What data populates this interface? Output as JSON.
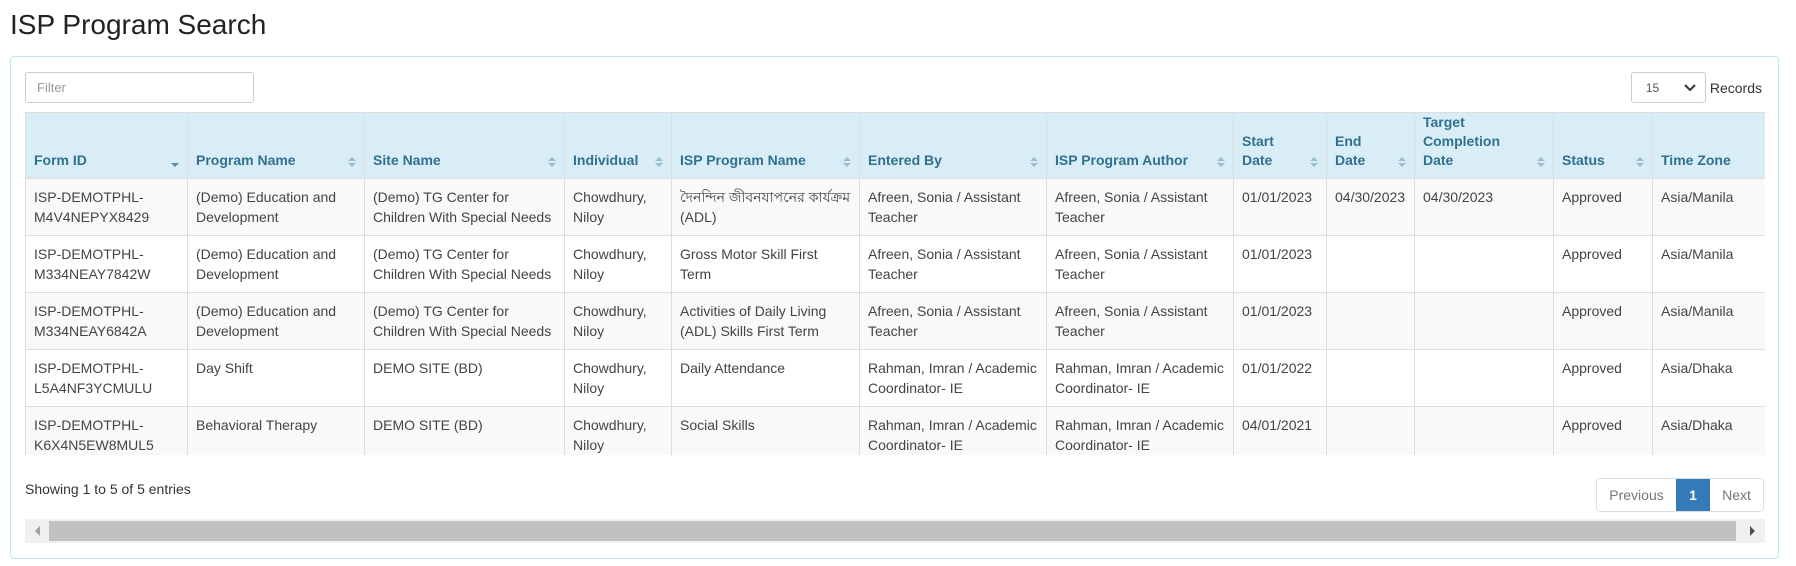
{
  "page": {
    "title": "ISP Program Search"
  },
  "toolbar": {
    "filter_placeholder": "Filter",
    "filter_value": "",
    "records_value": "15",
    "records_label": "Records"
  },
  "table": {
    "columns": [
      {
        "label": "Form ID",
        "sort": "desc"
      },
      {
        "label": "Program Name",
        "sort": "none"
      },
      {
        "label": "Site Name",
        "sort": "none"
      },
      {
        "label": "Individual",
        "sort": "none"
      },
      {
        "label": "ISP Program Name",
        "sort": "none"
      },
      {
        "label": "Entered By",
        "sort": "none"
      },
      {
        "label": "ISP Program Author",
        "sort": "none"
      },
      {
        "label": "Start Date",
        "sort": "none"
      },
      {
        "label": "End Date",
        "sort": "none"
      },
      {
        "label": "Target Completion Date",
        "sort": "none"
      },
      {
        "label": "Status",
        "sort": "none"
      },
      {
        "label": "Time Zone",
        "sort": "none"
      }
    ],
    "rows": [
      [
        "ISP-DEMOTPHL-M4V4NEPYX8429",
        "(Demo) Education and Development",
        "(Demo) TG Center for Children With Special Needs",
        "Chowdhury, Niloy",
        "দৈনন্দিন জীবনযাপনের কার্যক্রম (ADL)",
        "Afreen, Sonia / Assistant Teacher",
        "Afreen, Sonia / Assistant Teacher",
        "01/01/2023",
        "04/30/2023",
        "04/30/2023",
        "Approved",
        "Asia/Manila"
      ],
      [
        "ISP-DEMOTPHL-M334NEAY7842W",
        "(Demo) Education and Development",
        "(Demo) TG Center for Children With Special Needs",
        "Chowdhury, Niloy",
        "Gross Motor Skill First Term",
        "Afreen, Sonia / Assistant Teacher",
        "Afreen, Sonia / Assistant Teacher",
        "01/01/2023",
        "",
        "",
        "Approved",
        "Asia/Manila"
      ],
      [
        "ISP-DEMOTPHL-M334NEAY6842A",
        "(Demo) Education and Development",
        "(Demo) TG Center for Children With Special Needs",
        "Chowdhury, Niloy",
        "Activities of Daily Living (ADL) Skills First Term",
        "Afreen, Sonia / Assistant Teacher",
        "Afreen, Sonia / Assistant Teacher",
        "01/01/2023",
        "",
        "",
        "Approved",
        "Asia/Manila"
      ],
      [
        "ISP-DEMOTPHL-L5A4NF3YCMULU",
        "Day Shift",
        "DEMO SITE (BD)",
        "Chowdhury, Niloy",
        "Daily Attendance",
        "Rahman, Imran / Academic Coordinator- IE",
        "Rahman, Imran / Academic Coordinator- IE",
        "01/01/2022",
        "",
        "",
        "Approved",
        "Asia/Dhaka"
      ],
      [
        "ISP-DEMOTPHL-K6X4N5EW8MUL5",
        "Behavioral Therapy",
        "DEMO SITE (BD)",
        "Chowdhury, Niloy",
        "Social Skills",
        "Rahman, Imran / Academic Coordinator- IE",
        "Rahman, Imran / Academic Coordinator- IE",
        "04/01/2021",
        "",
        "",
        "Approved",
        "Asia/Dhaka"
      ]
    ]
  },
  "footer": {
    "info": "Showing 1 to 5 of 5 entries",
    "pagination": {
      "previous": "Previous",
      "current": "1",
      "next": "Next"
    }
  },
  "colors": {
    "header_bg": "#d9edf7",
    "header_text": "#31708f",
    "panel_border": "#bce8f1",
    "active_page": "#337ab7"
  }
}
